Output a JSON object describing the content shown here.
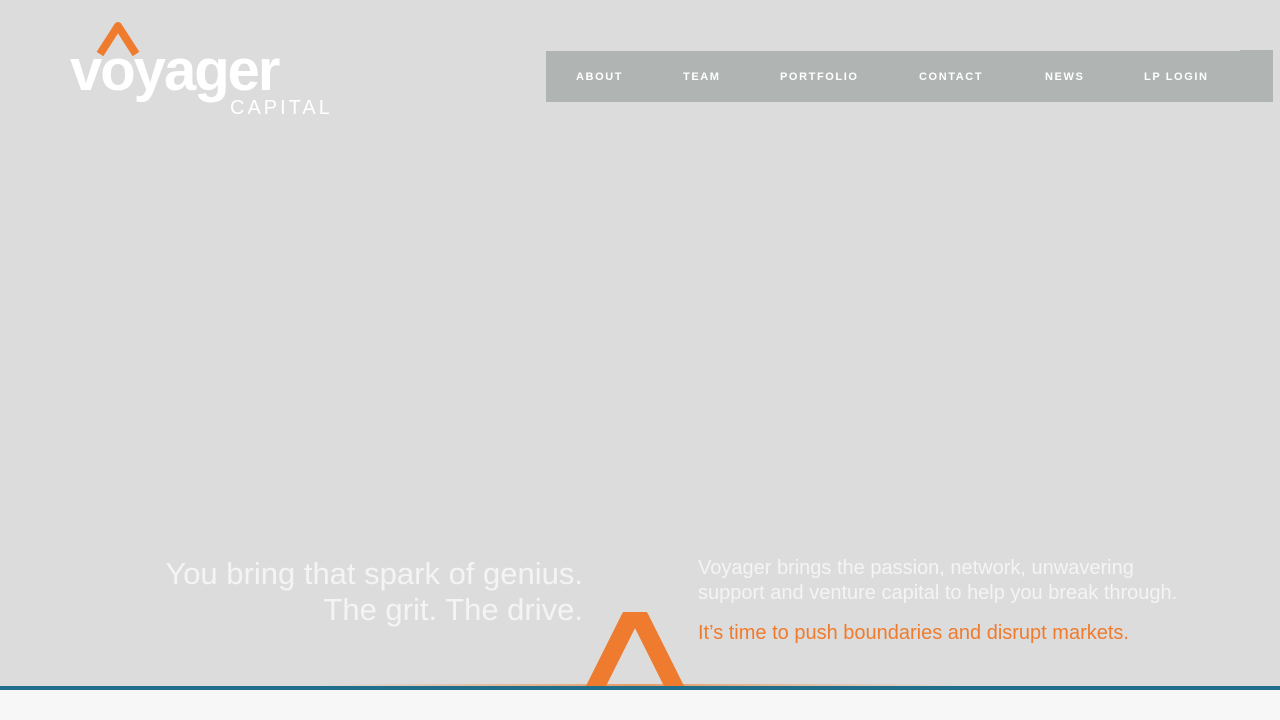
{
  "brand": {
    "name": "voyager",
    "sub": "CAPITAL",
    "accent": "#ee7b2e",
    "rule_color": "#1f6f8b"
  },
  "nav": {
    "items": [
      {
        "label": "ABOUT"
      },
      {
        "label": "TEAM"
      },
      {
        "label": "PORTFOLIO"
      },
      {
        "label": "CONTACT"
      },
      {
        "label": "NEWS"
      },
      {
        "label": "LP LOGIN"
      }
    ]
  },
  "hero": {
    "headline_line1": "You bring that spark of genius.",
    "headline_line2": "The grit. The drive.",
    "body": "Voyager brings the passion, network, unwavering support and venture capital to help you break through.",
    "accent_line": "It’s time to push boundaries and disrupt markets."
  },
  "icons": {
    "logo_mark": "chevron-up-icon",
    "hero_mark": "chevron-up-icon"
  }
}
